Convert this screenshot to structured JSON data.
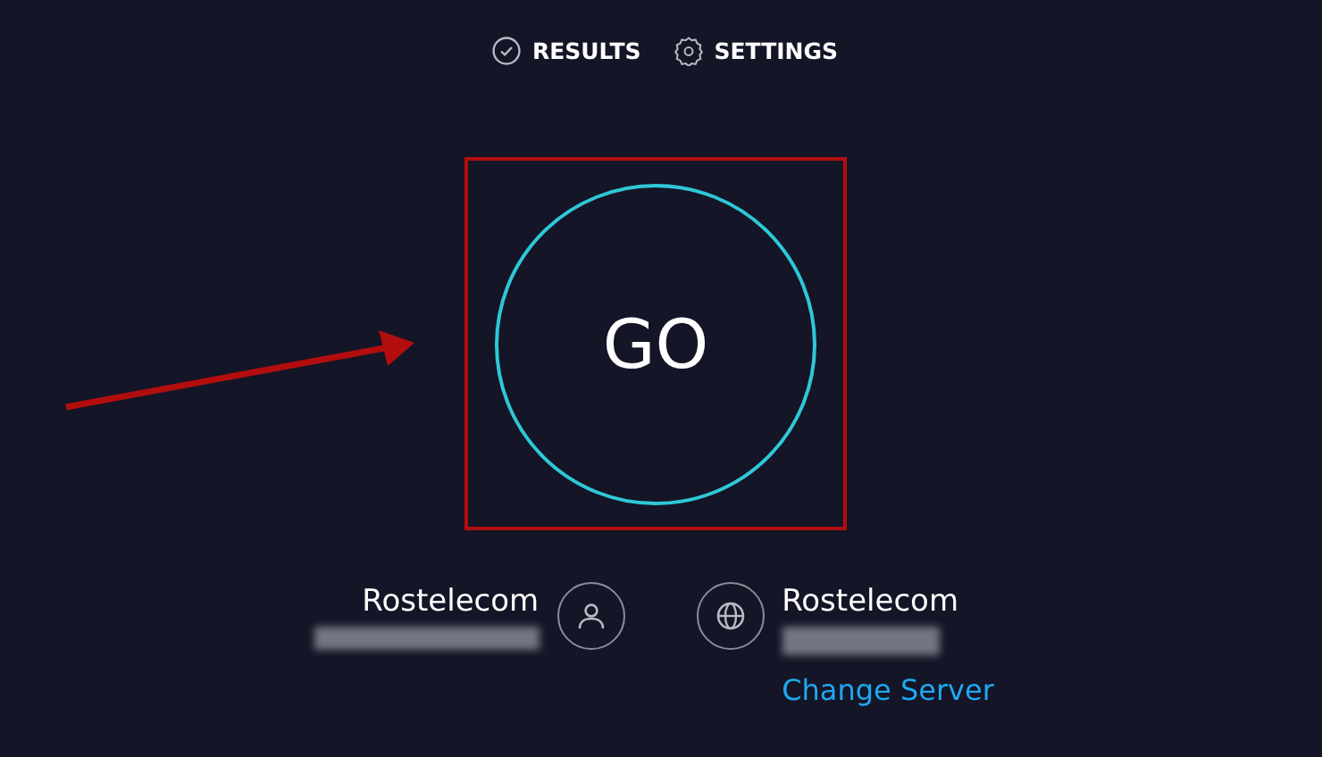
{
  "nav": [
    {
      "kind": "results",
      "label": "RESULTS"
    },
    {
      "kind": "settings",
      "label": "SETTINGS"
    }
  ],
  "go_button": {
    "label": "GO"
  },
  "provider": {
    "name": "Rostelecom"
  },
  "server": {
    "name": "Rostelecom",
    "link": "Change Server"
  }
}
